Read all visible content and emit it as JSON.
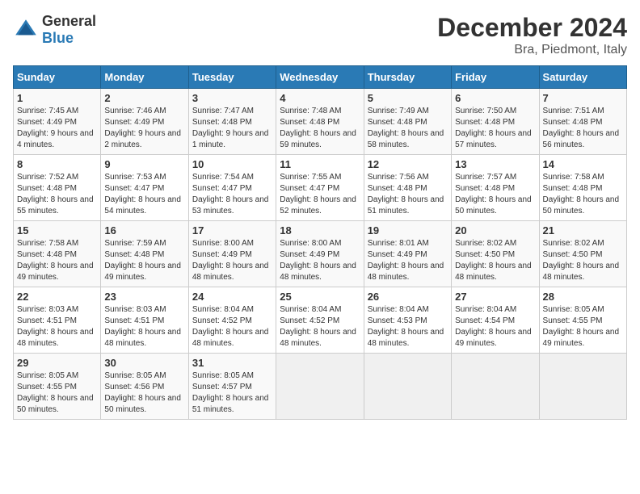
{
  "header": {
    "logo_general": "General",
    "logo_blue": "Blue",
    "month_title": "December 2024",
    "location": "Bra, Piedmont, Italy"
  },
  "weekdays": [
    "Sunday",
    "Monday",
    "Tuesday",
    "Wednesday",
    "Thursday",
    "Friday",
    "Saturday"
  ],
  "rows": [
    [
      {
        "day": "1",
        "sunrise": "7:45 AM",
        "sunset": "4:49 PM",
        "daylight": "9 hours and 4 minutes."
      },
      {
        "day": "2",
        "sunrise": "7:46 AM",
        "sunset": "4:49 PM",
        "daylight": "9 hours and 2 minutes."
      },
      {
        "day": "3",
        "sunrise": "7:47 AM",
        "sunset": "4:48 PM",
        "daylight": "9 hours and 1 minute."
      },
      {
        "day": "4",
        "sunrise": "7:48 AM",
        "sunset": "4:48 PM",
        "daylight": "8 hours and 59 minutes."
      },
      {
        "day": "5",
        "sunrise": "7:49 AM",
        "sunset": "4:48 PM",
        "daylight": "8 hours and 58 minutes."
      },
      {
        "day": "6",
        "sunrise": "7:50 AM",
        "sunset": "4:48 PM",
        "daylight": "8 hours and 57 minutes."
      },
      {
        "day": "7",
        "sunrise": "7:51 AM",
        "sunset": "4:48 PM",
        "daylight": "8 hours and 56 minutes."
      }
    ],
    [
      {
        "day": "8",
        "sunrise": "7:52 AM",
        "sunset": "4:48 PM",
        "daylight": "8 hours and 55 minutes."
      },
      {
        "day": "9",
        "sunrise": "7:53 AM",
        "sunset": "4:47 PM",
        "daylight": "8 hours and 54 minutes."
      },
      {
        "day": "10",
        "sunrise": "7:54 AM",
        "sunset": "4:47 PM",
        "daylight": "8 hours and 53 minutes."
      },
      {
        "day": "11",
        "sunrise": "7:55 AM",
        "sunset": "4:47 PM",
        "daylight": "8 hours and 52 minutes."
      },
      {
        "day": "12",
        "sunrise": "7:56 AM",
        "sunset": "4:48 PM",
        "daylight": "8 hours and 51 minutes."
      },
      {
        "day": "13",
        "sunrise": "7:57 AM",
        "sunset": "4:48 PM",
        "daylight": "8 hours and 50 minutes."
      },
      {
        "day": "14",
        "sunrise": "7:58 AM",
        "sunset": "4:48 PM",
        "daylight": "8 hours and 50 minutes."
      }
    ],
    [
      {
        "day": "15",
        "sunrise": "7:58 AM",
        "sunset": "4:48 PM",
        "daylight": "8 hours and 49 minutes."
      },
      {
        "day": "16",
        "sunrise": "7:59 AM",
        "sunset": "4:48 PM",
        "daylight": "8 hours and 49 minutes."
      },
      {
        "day": "17",
        "sunrise": "8:00 AM",
        "sunset": "4:49 PM",
        "daylight": "8 hours and 48 minutes."
      },
      {
        "day": "18",
        "sunrise": "8:00 AM",
        "sunset": "4:49 PM",
        "daylight": "8 hours and 48 minutes."
      },
      {
        "day": "19",
        "sunrise": "8:01 AM",
        "sunset": "4:49 PM",
        "daylight": "8 hours and 48 minutes."
      },
      {
        "day": "20",
        "sunrise": "8:02 AM",
        "sunset": "4:50 PM",
        "daylight": "8 hours and 48 minutes."
      },
      {
        "day": "21",
        "sunrise": "8:02 AM",
        "sunset": "4:50 PM",
        "daylight": "8 hours and 48 minutes."
      }
    ],
    [
      {
        "day": "22",
        "sunrise": "8:03 AM",
        "sunset": "4:51 PM",
        "daylight": "8 hours and 48 minutes."
      },
      {
        "day": "23",
        "sunrise": "8:03 AM",
        "sunset": "4:51 PM",
        "daylight": "8 hours and 48 minutes."
      },
      {
        "day": "24",
        "sunrise": "8:04 AM",
        "sunset": "4:52 PM",
        "daylight": "8 hours and 48 minutes."
      },
      {
        "day": "25",
        "sunrise": "8:04 AM",
        "sunset": "4:52 PM",
        "daylight": "8 hours and 48 minutes."
      },
      {
        "day": "26",
        "sunrise": "8:04 AM",
        "sunset": "4:53 PM",
        "daylight": "8 hours and 48 minutes."
      },
      {
        "day": "27",
        "sunrise": "8:04 AM",
        "sunset": "4:54 PM",
        "daylight": "8 hours and 49 minutes."
      },
      {
        "day": "28",
        "sunrise": "8:05 AM",
        "sunset": "4:55 PM",
        "daylight": "8 hours and 49 minutes."
      }
    ],
    [
      {
        "day": "29",
        "sunrise": "8:05 AM",
        "sunset": "4:55 PM",
        "daylight": "8 hours and 50 minutes."
      },
      {
        "day": "30",
        "sunrise": "8:05 AM",
        "sunset": "4:56 PM",
        "daylight": "8 hours and 50 minutes."
      },
      {
        "day": "31",
        "sunrise": "8:05 AM",
        "sunset": "4:57 PM",
        "daylight": "8 hours and 51 minutes."
      },
      null,
      null,
      null,
      null
    ]
  ]
}
